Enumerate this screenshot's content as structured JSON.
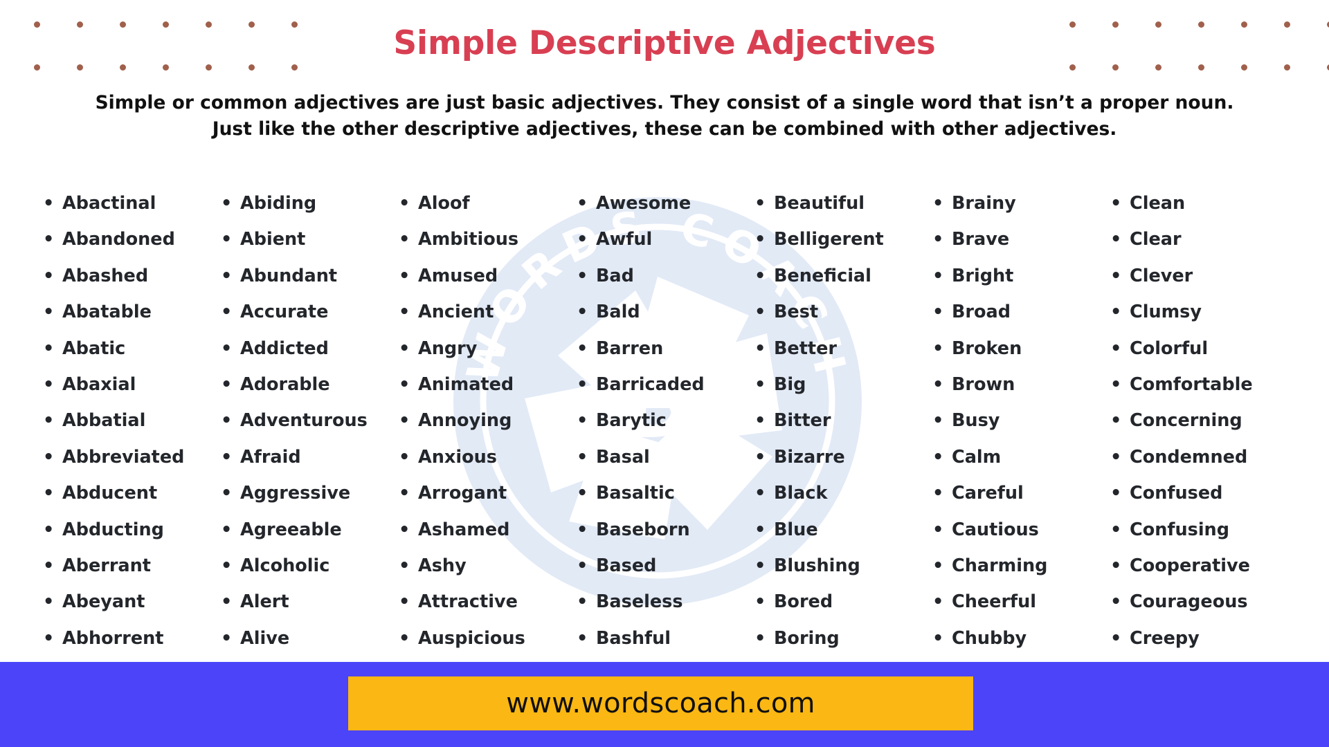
{
  "header": {
    "title": "Simple Descriptive Adjectives",
    "title_color": "#d83f52",
    "subtitle_line_1": "Simple or common adjectives are just basic adjectives. They consist of a single word that isn’t a proper noun.",
    "subtitle_line_2": "Just like the other descriptive adjectives, these can be combined with other adjectives."
  },
  "decor": {
    "dot_color": "#a0604c",
    "dot_rows": 2,
    "dot_cols": 7
  },
  "watermark": {
    "brand_text": "WORDS COACH",
    "center_letter": "D",
    "tint_color": "#e2eaf6"
  },
  "columns": [
    {
      "id": "column-1",
      "items": [
        "Abactinal",
        "Abandoned",
        "Abashed",
        "Abatable",
        "Abatic",
        "Abaxial",
        "Abbatial",
        "Abbreviated",
        "Abducent",
        "Abducting",
        "Aberrant",
        "Abeyant",
        "Abhorrent"
      ]
    },
    {
      "id": "column-2",
      "items": [
        "Abiding",
        "Abient",
        "Abundant",
        "Accurate",
        "Addicted",
        "Adorable",
        "Adventurous",
        "Afraid",
        "Aggressive",
        "Agreeable",
        "Alcoholic",
        "Alert",
        "Alive"
      ]
    },
    {
      "id": "column-3",
      "items": [
        "Aloof",
        "Ambitious",
        "Amused",
        "Ancient",
        "Angry",
        "Animated",
        "Annoying",
        "Anxious",
        "Arrogant",
        "Ashamed",
        "Ashy",
        "Attractive",
        "Auspicious"
      ]
    },
    {
      "id": "column-4",
      "items": [
        "Awesome",
        "Awful",
        "Bad",
        "Bald",
        "Barren",
        "Barricaded",
        "Barytic",
        "Basal",
        "Basaltic",
        "Baseborn",
        "Based",
        "Baseless",
        "Bashful"
      ]
    },
    {
      "id": "column-5",
      "items": [
        "Beautiful",
        "Belligerent",
        "Beneficial",
        "Best",
        "Better",
        "Big",
        "Bitter",
        "Bizarre",
        "Black",
        "Blue",
        "Blushing",
        "Bored",
        "Boring"
      ]
    },
    {
      "id": "column-6",
      "items": [
        "Brainy",
        "Brave",
        "Bright",
        "Broad",
        "Broken",
        "Brown",
        "Busy",
        "Calm",
        "Careful",
        "Cautious",
        "Charming",
        "Cheerful",
        "Chubby"
      ]
    },
    {
      "id": "column-7",
      "items": [
        "Clean",
        "Clear",
        "Clever",
        "Clumsy",
        "Colorful",
        "Comfortable",
        "Concerning",
        "Condemned",
        "Confused",
        "Confusing",
        "Cooperative",
        "Courageous",
        "Creepy"
      ]
    }
  ],
  "footer": {
    "url": "www.wordscoach.com",
    "band_color": "#4c44f8",
    "badge_color": "#fbb713"
  },
  "bullet_glyph": "•"
}
